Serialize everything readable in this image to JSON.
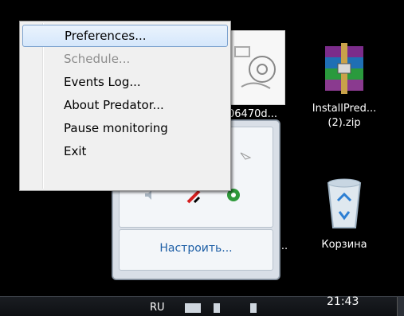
{
  "menu": {
    "items": [
      {
        "label": "Preferences...",
        "state": "selected"
      },
      {
        "label": "Schedule...",
        "state": "disabled"
      },
      {
        "label": "Events Log...",
        "state": "normal"
      },
      {
        "label": "About Predator...",
        "state": "normal"
      },
      {
        "label": "Pause monitoring",
        "state": "normal"
      },
      {
        "label": "Exit",
        "state": "normal"
      }
    ]
  },
  "desktop": {
    "doc_icon_label": "06470d...",
    "zip_icon_label_line1": "InstallPred...",
    "zip_icon_label_line2": "(2).zip",
    "recycle_bin_label": "Корзина",
    "fragment_label": "-..."
  },
  "tray_popup": {
    "customize_link": "Настроить..."
  },
  "taskbar": {
    "language": "RU",
    "clock": "21:43"
  },
  "colors": {
    "menu_selection": "#d5e7fb",
    "link": "#1e5fa6",
    "desktop": "#000000"
  }
}
